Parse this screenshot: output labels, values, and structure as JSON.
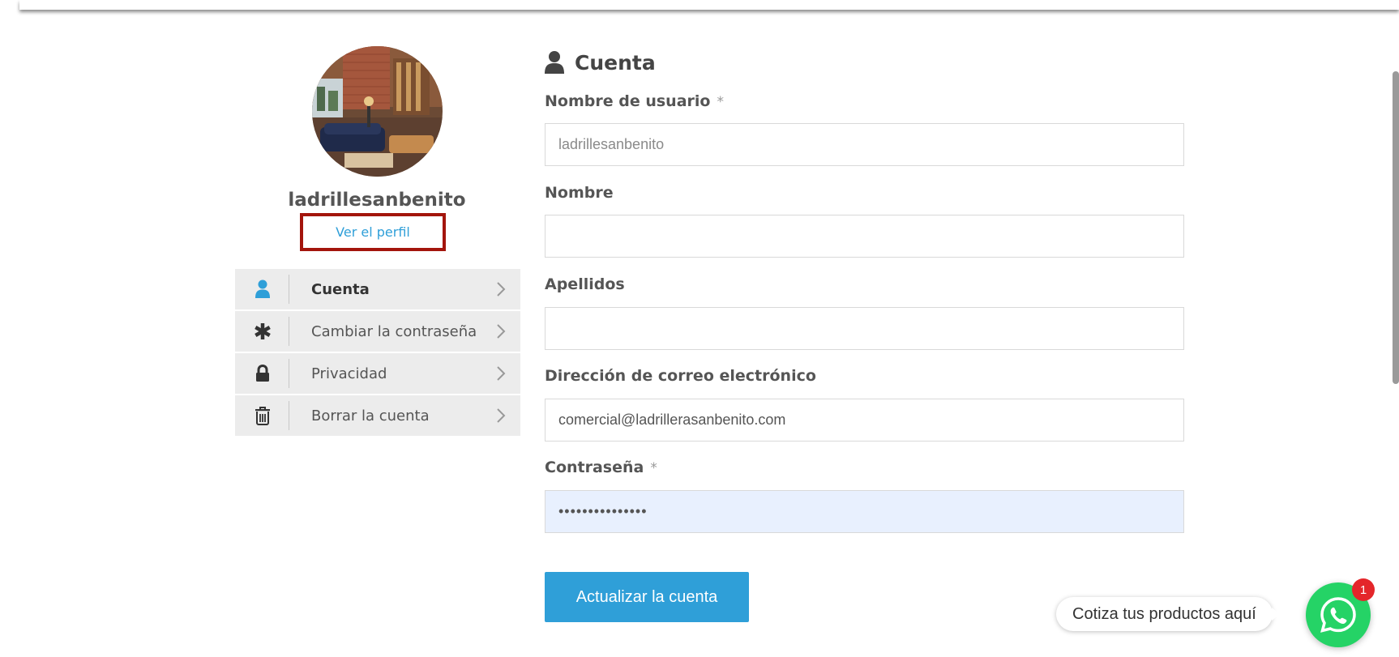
{
  "profile": {
    "username": "ladrillesanbenito",
    "view_profile_link": "Ver el perfil"
  },
  "side_menu": {
    "items": [
      {
        "label": "Cuenta",
        "icon": "user-icon",
        "active": true
      },
      {
        "label": "Cambiar la contraseña",
        "icon": "asterisk-icon",
        "active": false
      },
      {
        "label": "Privacidad",
        "icon": "lock-icon",
        "active": false
      },
      {
        "label": "Borrar la cuenta",
        "icon": "trash-icon",
        "active": false
      }
    ]
  },
  "form": {
    "title": "Cuenta",
    "username": {
      "label": "Nombre de usuario",
      "required_mark": "*",
      "value": "ladrillesanbenito"
    },
    "first_name": {
      "label": "Nombre",
      "value": ""
    },
    "last_name": {
      "label": "Apellidos",
      "value": ""
    },
    "email": {
      "label": "Dirección de correo electrónico",
      "value": "comercial@ladrillerasanbenito.com"
    },
    "password": {
      "label": "Contraseña",
      "required_mark": "*",
      "value": "•••••••••••••••"
    },
    "submit_label": "Actualizar la cuenta"
  },
  "whatsapp_widget": {
    "tooltip": "Cotiza tus productos aquí",
    "badge_count": "1",
    "icon": "whatsapp-icon"
  },
  "colors": {
    "accent": "#2f9fd8",
    "highlight_border": "#a3150c",
    "whatsapp": "#25d366",
    "badge": "#e4262a",
    "autofill": "#e8f0fe"
  }
}
